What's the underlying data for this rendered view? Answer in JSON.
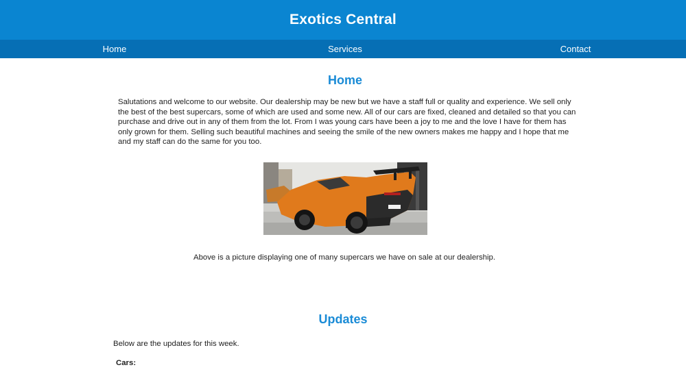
{
  "header": {
    "title": "Exotics Central"
  },
  "nav": {
    "items": [
      {
        "label": "Home"
      },
      {
        "label": "Services"
      },
      {
        "label": "Contact"
      }
    ]
  },
  "home": {
    "heading": "Home",
    "paragraph": "Salutations and welcome to our website. Our dealership may be new but we have a staff full or quality and experience. We sell only the best of the best supercars, some of which are used and some new. All of our cars are fixed, cleaned and detailed so that you can purchase and drive out in any of them from the lot. From I was young cars have been a joy to me and the love I have for them has only grown for them. Selling such beautiful machines and seeing the smile of the new owners makes me happy and I hope that me and my staff can do the same for you too.",
    "image_caption": "Above is a picture displaying one of many supercars we have on sale at our dealership."
  },
  "updates": {
    "heading": "Updates",
    "intro": "Below are the updates for this week.",
    "cars_label": "Cars:"
  },
  "colors": {
    "header_bg": "#0a85d1",
    "nav_bg": "#066fb5",
    "heading_color": "#1a8bd6",
    "car_orange": "#e07a1c"
  }
}
